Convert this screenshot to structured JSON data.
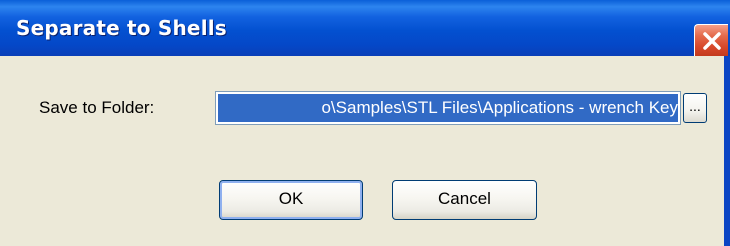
{
  "window": {
    "title": "Separate to Shells",
    "close_icon": "close-icon"
  },
  "form": {
    "folder_label": "Save to Folder:",
    "folder_value": "o\\Samples\\STL Files\\Applications - wrench Key",
    "browse_label": "..."
  },
  "buttons": {
    "ok_label": "OK",
    "cancel_label": "Cancel"
  },
  "colors": {
    "title_bar": "#0350d0",
    "close_button": "#d8482a",
    "dialog_bg": "#ece9d8",
    "selection": "#316ac5"
  }
}
